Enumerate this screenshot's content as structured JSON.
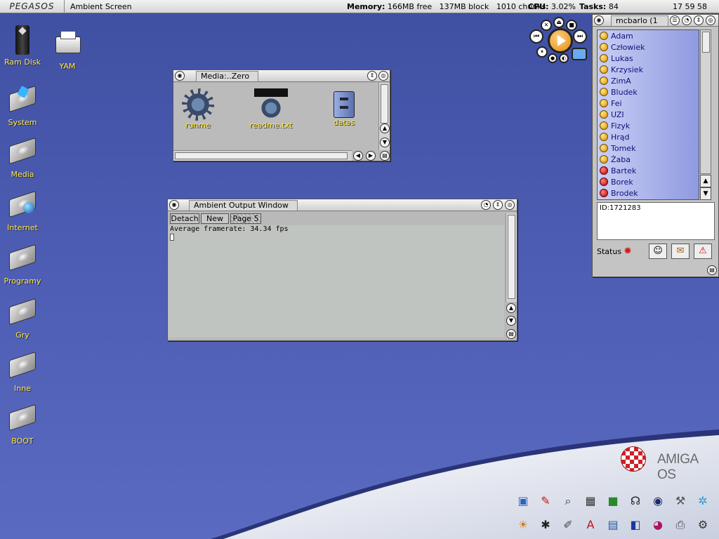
{
  "screenbar": {
    "logo": "PEGASOS",
    "title": "Ambient Screen",
    "memory_label": "Memory:",
    "memory_free": "166MB free",
    "memory_block": "137MB block",
    "memory_chunks": "1010 chunks",
    "cpu_label": "CPU:",
    "cpu_value": "3.02%",
    "tasks_label": "Tasks:",
    "tasks_value": "84",
    "clock": "17 59 58"
  },
  "desktop_icons": [
    {
      "label": "Ram Disk",
      "icon": "ram-disk-icon"
    },
    {
      "label": "YAM",
      "icon": "mail-icon"
    },
    {
      "label": "System",
      "icon": "drive-icon"
    },
    {
      "label": "Media",
      "icon": "drive-icon"
    },
    {
      "label": "Internet",
      "icon": "drive-icon"
    },
    {
      "label": "Programy",
      "icon": "drive-icon"
    },
    {
      "label": "Gry",
      "icon": "drive-icon"
    },
    {
      "label": "Inne",
      "icon": "drive-icon"
    },
    {
      "label": "BOOT",
      "icon": "drive-icon"
    }
  ],
  "media_window": {
    "title": "Media:..Zero",
    "files": [
      {
        "label": "runme",
        "icon": "gear-icon"
      },
      {
        "label": "readme.txt",
        "icon": "text-file-icon"
      },
      {
        "label": "datas",
        "icon": "drawer-icon"
      }
    ]
  },
  "output_window": {
    "title": "Ambient Output Window",
    "buttons": [
      "Detach",
      "New",
      "Page 5"
    ],
    "output_line": "Average framerate:   34.34 fps"
  },
  "im_window": {
    "title": "mcbarlo (1",
    "contacts": [
      {
        "name": "Adam",
        "status": "online"
      },
      {
        "name": "Człowiek",
        "status": "online"
      },
      {
        "name": "Lukas",
        "status": "online"
      },
      {
        "name": "Krzysiek",
        "status": "online"
      },
      {
        "name": "ZimA",
        "status": "online"
      },
      {
        "name": "Bludek",
        "status": "online"
      },
      {
        "name": "Fei",
        "status": "online"
      },
      {
        "name": "UZI",
        "status": "online"
      },
      {
        "name": "Fizyk",
        "status": "online"
      },
      {
        "name": "Hrąd",
        "status": "online"
      },
      {
        "name": "Tomek",
        "status": "online"
      },
      {
        "name": "Żaba",
        "status": "online"
      },
      {
        "name": "Bartek",
        "status": "busy"
      },
      {
        "name": "Borek",
        "status": "busy"
      },
      {
        "name": "Brodek",
        "status": "busy"
      }
    ],
    "info_text": "ID:1721283",
    "status_label": "Status"
  },
  "branding": {
    "text": "AMIGA OS",
    "accent": "#d0202a"
  }
}
